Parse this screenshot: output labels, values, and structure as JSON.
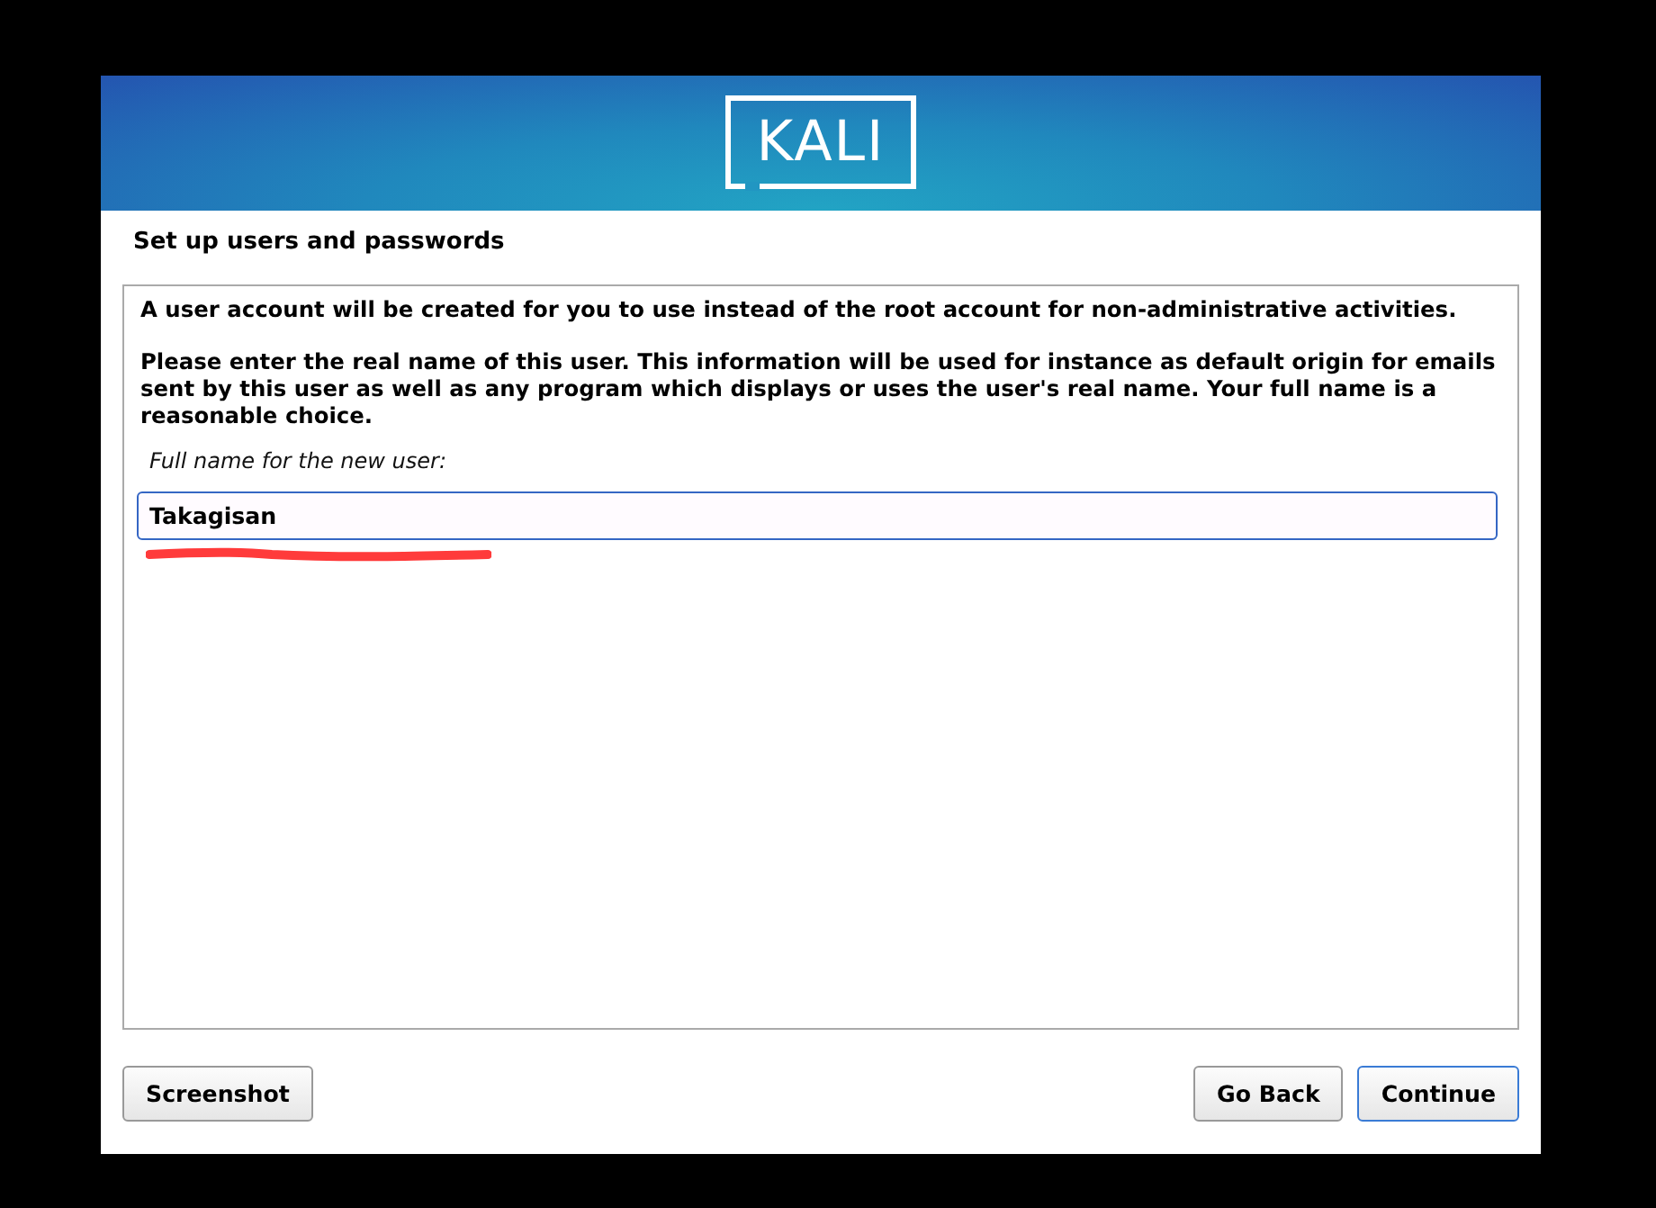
{
  "banner": {
    "logo": "KALI"
  },
  "title": "Set up users and passwords",
  "paragraphs": [
    "A user account will be created for you to use instead of the root account for non-administrative activities.",
    "Please enter the real name of this user. This information will be used for instance as default origin for emails sent by this user as well as any program which displays or uses the user's real name. Your full name is a reasonable choice."
  ],
  "field": {
    "label": "Full name for the new user:",
    "value": "Takagisan",
    "focused": true,
    "annotated": true
  },
  "left_buttons": [
    {
      "label": "Screenshot",
      "focused": false
    }
  ],
  "right_buttons": [
    {
      "label": "Go Back",
      "focused": false
    },
    {
      "label": "Continue",
      "focused": true
    }
  ]
}
